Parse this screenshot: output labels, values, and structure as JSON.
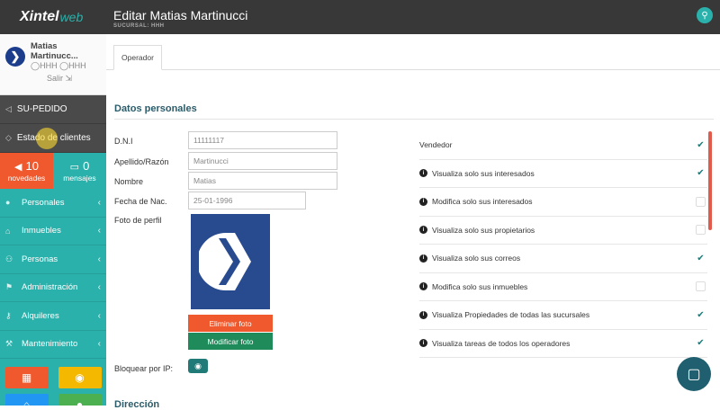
{
  "brand": {
    "logo_main": "Xintel",
    "logo_web": "web"
  },
  "user": {
    "name_line1": "Matias",
    "name_line2": "Martinucc...",
    "sucursal1": "HHH",
    "sucursal2": "HHH",
    "logout": "Salir"
  },
  "sidebar": {
    "top_items": [
      {
        "label": "SU-PEDIDO",
        "icon": "megaphone-icon"
      },
      {
        "label": "Estado de clientes",
        "icon": "tag-icon"
      }
    ],
    "counters": [
      {
        "count": "10",
        "label": "novedades",
        "icon": "megaphone-icon"
      },
      {
        "count": "0",
        "label": "mensajes",
        "icon": "chat-icon"
      }
    ],
    "items": [
      {
        "label": "Personales",
        "icon": "user-icon"
      },
      {
        "label": "Inmuebles",
        "icon": "home-icon"
      },
      {
        "label": "Personas",
        "icon": "people-icon"
      },
      {
        "label": "Administración",
        "icon": "flag-icon"
      },
      {
        "label": "Alquileres",
        "icon": "key-icon"
      },
      {
        "label": "Mantenimiento",
        "icon": "wrench-icon"
      }
    ]
  },
  "header": {
    "title": "Editar Matias Martinucci",
    "subtitle": "SUCURSAL: HHH"
  },
  "tabs": [
    {
      "label": "Operador"
    }
  ],
  "section": {
    "title": "Datos personales",
    "next_title": "Dirección"
  },
  "form": {
    "dni": {
      "label": "D.N.I",
      "value": "11111117"
    },
    "apellido": {
      "label": "Apellido/Razón",
      "value": "Martinucci"
    },
    "nombre": {
      "label": "Nombre",
      "value": "Matias"
    },
    "fecha": {
      "label": "Fecha de Nac.",
      "value": "25-01-1996"
    },
    "foto": {
      "label": "Foto de perfil",
      "delete": "Eliminar foto",
      "modify": "Modificar foto"
    },
    "ip": {
      "label": "Bloquear por IP:"
    }
  },
  "permissions": [
    {
      "label": "Vendedor",
      "info": false,
      "checked": true
    },
    {
      "label": "Visualiza solo sus interesados",
      "info": true,
      "checked": true
    },
    {
      "label": "Modifica solo sus interesados",
      "info": true,
      "checked": false
    },
    {
      "label": "Visualiza solo sus propietarios",
      "info": true,
      "checked": false
    },
    {
      "label": "Visualiza solo sus correos",
      "info": true,
      "checked": true
    },
    {
      "label": "Modifica solo sus inmuebles",
      "info": true,
      "checked": false
    },
    {
      "label": "Visualiza Propiedades de todas las sucursales",
      "info": true,
      "checked": true
    },
    {
      "label": "Visualiza tareas de todos los operadores",
      "info": true,
      "checked": true
    }
  ],
  "colors": {
    "teal": "#2bb1ab",
    "orange": "#f0582d",
    "dark": "#383838",
    "green": "#1f8a5a"
  }
}
